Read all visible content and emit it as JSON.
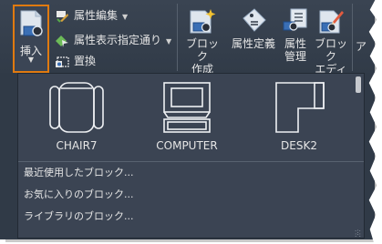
{
  "ribbon": {
    "insert_button": {
      "label": "挿入",
      "icon": "insert-block-icon"
    },
    "small_buttons": [
      {
        "label": "属性編集",
        "icon": "edit-attribute-icon",
        "has_dropdown": true
      },
      {
        "label": "属性表示指定通り",
        "icon": "attribute-display-icon",
        "has_dropdown": true
      },
      {
        "label": "置換",
        "icon": "replace-icon",
        "has_dropdown": false
      }
    ],
    "create_block": {
      "line1": "ブロック",
      "line2": "作成",
      "icon": "create-block-icon"
    },
    "define_attributes": {
      "label": "属性定義",
      "icon": "define-attributes-icon"
    },
    "manage_attributes": {
      "line1": "属性",
      "line2": "管理",
      "icon": "manage-attributes-icon"
    },
    "block_editor": {
      "line1": "ブロック",
      "line2": "エディタ",
      "icon": "block-editor-icon"
    },
    "next_panel_partial": "ア"
  },
  "gallery": {
    "tiles": [
      {
        "label": "CHAIR7",
        "icon": "chair-icon"
      },
      {
        "label": "COMPUTER",
        "icon": "computer-icon"
      },
      {
        "label": "DESK2",
        "icon": "desk-icon"
      }
    ],
    "menu_items": [
      "最近使用したブロック...",
      "お気に入りのブロック...",
      "ライブラリのブロック..."
    ]
  },
  "colors": {
    "ribbon_bg": "#303a47",
    "dropdown_bg": "#3b4453",
    "highlight": "#e07a10",
    "text": "#e6e6e6"
  }
}
